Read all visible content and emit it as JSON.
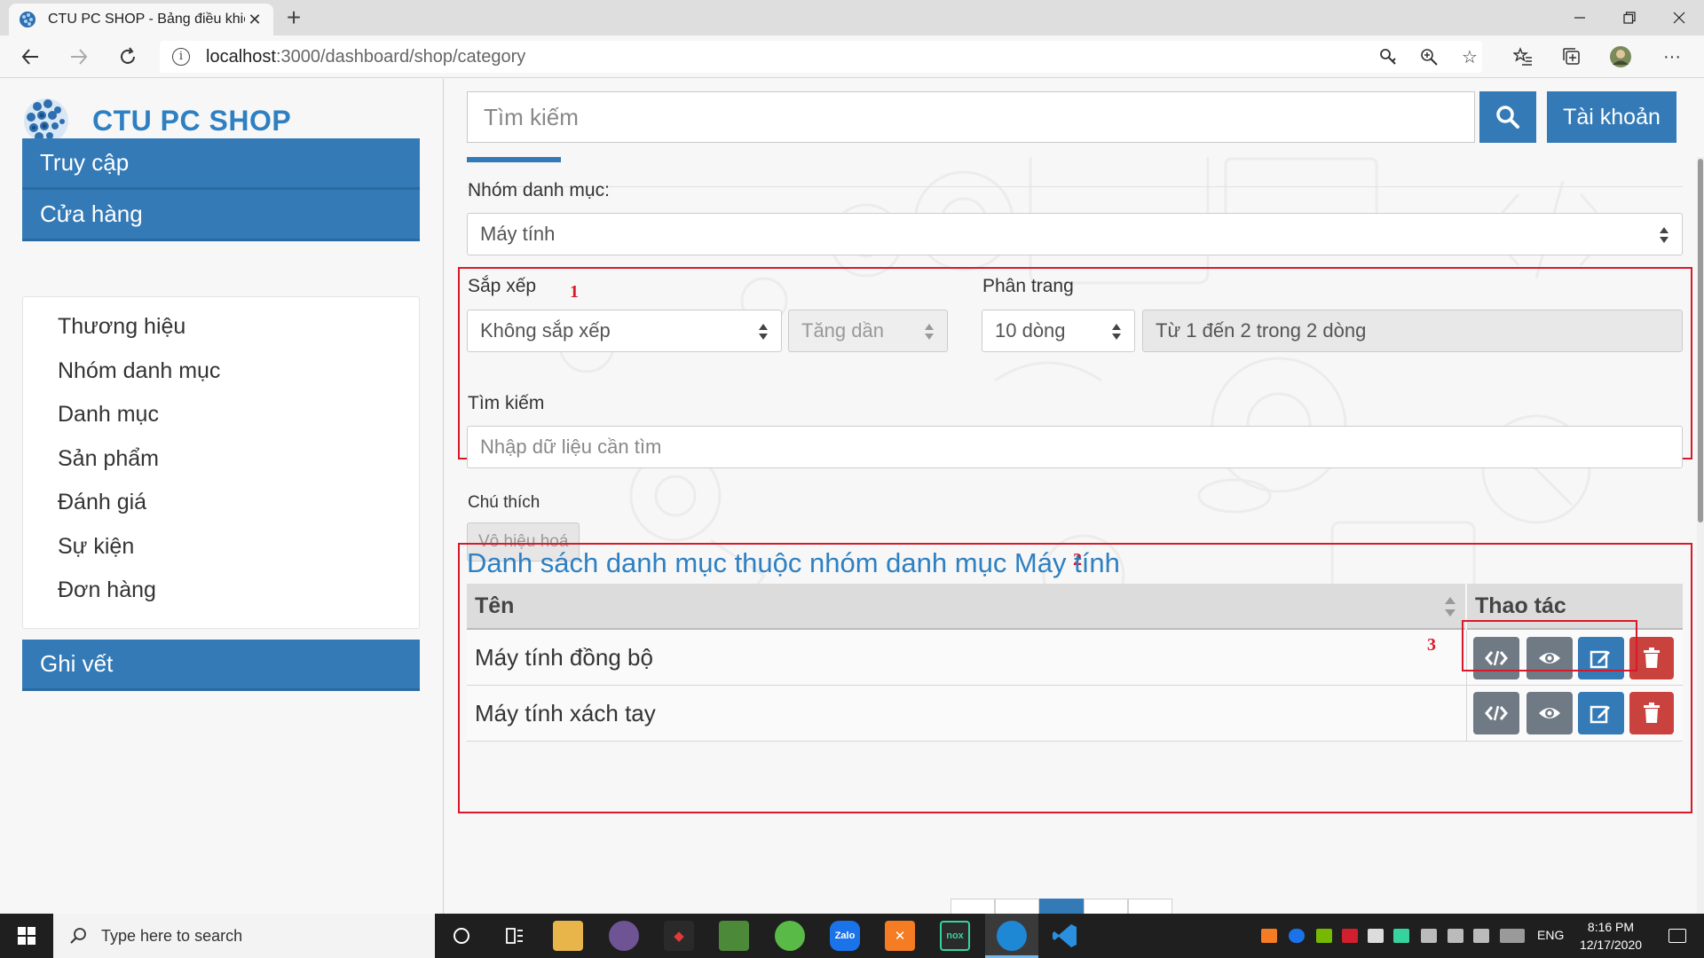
{
  "browser": {
    "tab_title": "CTU PC SHOP - Bảng điều khiển",
    "url_host": "localhost",
    "url_rest": ":3000/dashboard/shop/category"
  },
  "header": {
    "search_placeholder": "Tìm kiếm",
    "account_label": "Tài khoản"
  },
  "sidebar": {
    "brand": "CTU PC SHOP",
    "sections": [
      "Truy cập",
      "Cửa hàng",
      "Ghi vết"
    ],
    "shop_items": [
      "Thương hiệu",
      "Nhóm danh mục",
      "Danh mục",
      "Sản phẩm",
      "Đánh giá",
      "Sự kiện",
      "Đơn hàng"
    ]
  },
  "filters": {
    "group_label": "Nhóm danh mục:",
    "group_value": "Máy tính",
    "sort_label": "Sắp xếp",
    "sort_value": "Không sắp xếp",
    "order_value": "Tăng dần",
    "paging_label": "Phân trang",
    "paging_value": "10 dòng",
    "paging_info": "Từ 1 đến 2 trong 2 dòng",
    "search_label": "Tìm kiếm",
    "search_placeholder": "Nhập dữ liệu cần tìm",
    "note_label": "Chú thích",
    "note_button": "Vô hiệu hoá"
  },
  "annotations": [
    "1",
    "2",
    "3"
  ],
  "list": {
    "title": "Danh sách danh mục thuộc nhóm danh mục Máy tính",
    "columns": [
      "Tên",
      "Thao tác"
    ],
    "rows": [
      "Máy tính đồng bộ",
      "Máy tính xách tay"
    ],
    "action_icons": [
      "code-icon",
      "eye-icon",
      "edit-icon",
      "trash-icon"
    ]
  },
  "taskbar": {
    "search_placeholder": "Type here to search",
    "lang": "ENG",
    "time": "8:16 PM",
    "date": "12/17/2020"
  },
  "colors": {
    "primary": "#337ab7",
    "brand_text": "#2e80c2",
    "danger": "#c9423e",
    "secondary_button": "#6f7a85",
    "annotation_red": "#d9192a"
  }
}
